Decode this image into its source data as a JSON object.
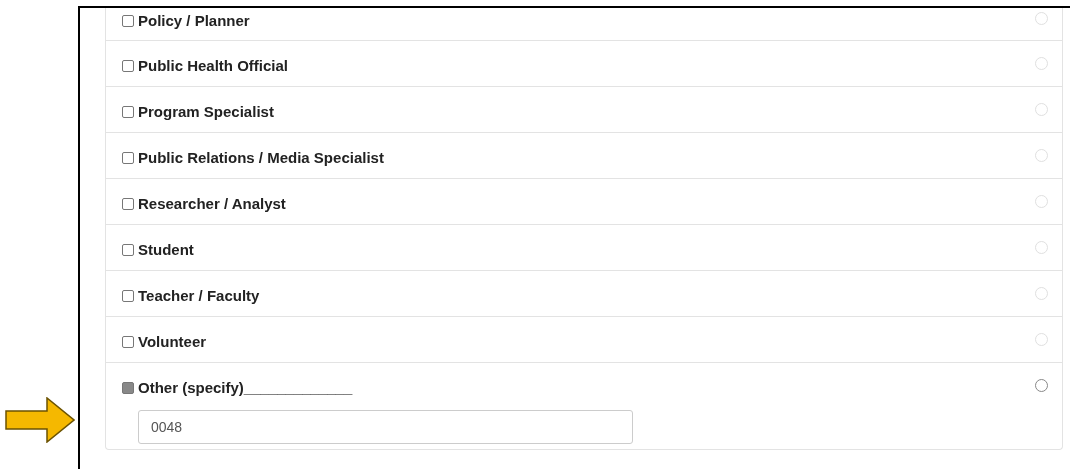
{
  "options": [
    {
      "label": "Policy / Planner",
      "checked": false,
      "radio_disabled": true
    },
    {
      "label": "Public Health Official",
      "checked": false,
      "radio_disabled": true
    },
    {
      "label": "Program Specialist",
      "checked": false,
      "radio_disabled": true
    },
    {
      "label": "Public Relations / Media Specialist",
      "checked": false,
      "radio_disabled": true
    },
    {
      "label": "Researcher / Analyst",
      "checked": false,
      "radio_disabled": true
    },
    {
      "label": "Student",
      "checked": false,
      "radio_disabled": true
    },
    {
      "label": "Teacher / Faculty",
      "checked": false,
      "radio_disabled": true
    },
    {
      "label": "Volunteer",
      "checked": false,
      "radio_disabled": true
    },
    {
      "label": "Other (specify)_____________",
      "checked": true,
      "radio_disabled": false,
      "kind": "specify",
      "value": "0048"
    }
  ]
}
